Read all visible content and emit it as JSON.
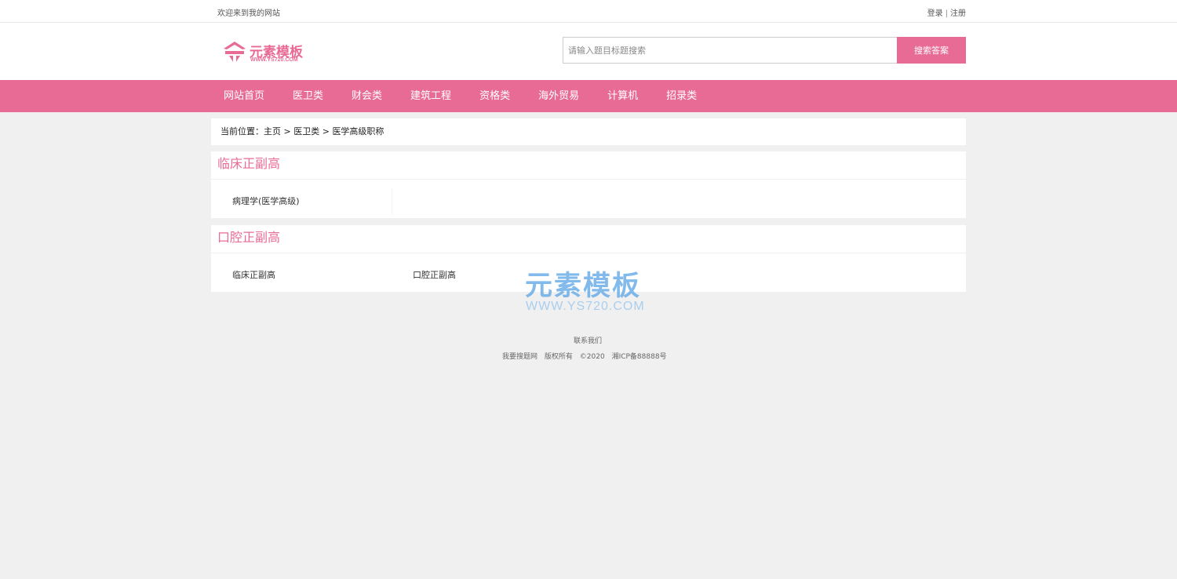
{
  "topbar": {
    "welcome": "欢迎来到我的网站",
    "login": "登录",
    "separator": "|",
    "register": "注册"
  },
  "header": {
    "logo_text": "元素模板",
    "logo_sub": "WWW.YS720.COM",
    "search_placeholder": "请输入题目标题搜索",
    "search_button": "搜索答案"
  },
  "nav": {
    "items": [
      "网站首页",
      "医卫类",
      "财会类",
      "建筑工程",
      "资格类",
      "海外贸易",
      "计算机",
      "招录类"
    ]
  },
  "breadcrumb": {
    "prefix": "当前位置：",
    "home": "主页",
    "sep": ">",
    "category": "医卫类",
    "current": "医学高级职称"
  },
  "sections": [
    {
      "title": "临床正副高",
      "items": [
        "病理学(医学高级)"
      ]
    },
    {
      "title": "口腔正副高",
      "items": [
        "临床正副高",
        "口腔正副高"
      ]
    }
  ],
  "watermark": {
    "main": "元素模板",
    "sub": "WWW.YS720.COM"
  },
  "footer": {
    "contact": "联系我们",
    "site_name": "我要搜题网",
    "rights": "版权所有",
    "year": "©2020",
    "icp": "湘ICP备88888号"
  },
  "colors": {
    "accent": "#e86b96",
    "background": "#f0f0f0"
  }
}
